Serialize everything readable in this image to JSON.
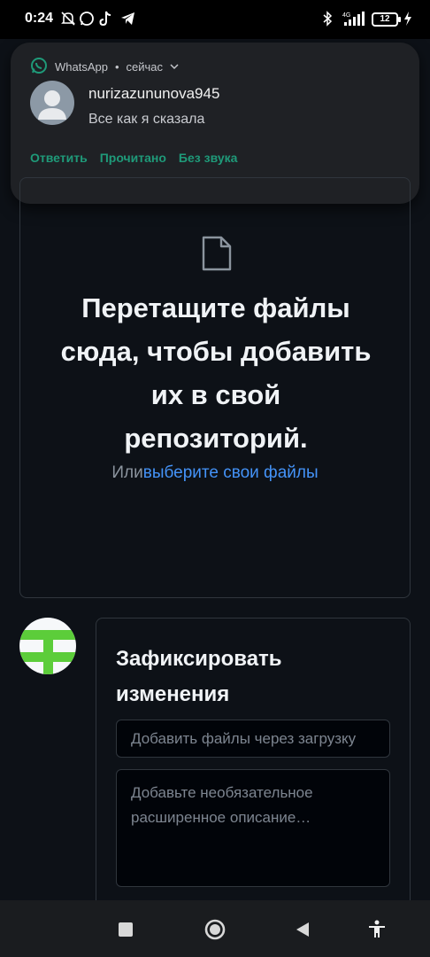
{
  "status_bar": {
    "time": "0:24",
    "battery": "12",
    "network": "4G"
  },
  "notification": {
    "app_name": "WhatsApp",
    "when": "сейчас",
    "sender": "nurizazununova945",
    "message": "Все как я сказала",
    "actions": [
      "Ответить",
      "Прочитано",
      "Без звука"
    ],
    "accent_color": "#1f9a79"
  },
  "dropzone": {
    "title": "Перетащите файлы сюда, чтобы добавить их в свой репозиторий.",
    "or_text": "Или",
    "link_text": "выберите свои файлы",
    "link_color": "#4493f8"
  },
  "commit": {
    "title": "Зафиксировать изменения",
    "summary_placeholder": "Добавить файлы через загрузку",
    "description_placeholder": "Добавьте необязательное расширенное описание…",
    "avatar_color": "#5ccd3a"
  },
  "icons": {
    "file": "file-icon",
    "whatsapp": "whatsapp-icon",
    "nav_recents": "square-icon",
    "nav_home": "circle-icon",
    "nav_back": "triangle-back-icon",
    "accessibility": "accessibility-icon"
  }
}
